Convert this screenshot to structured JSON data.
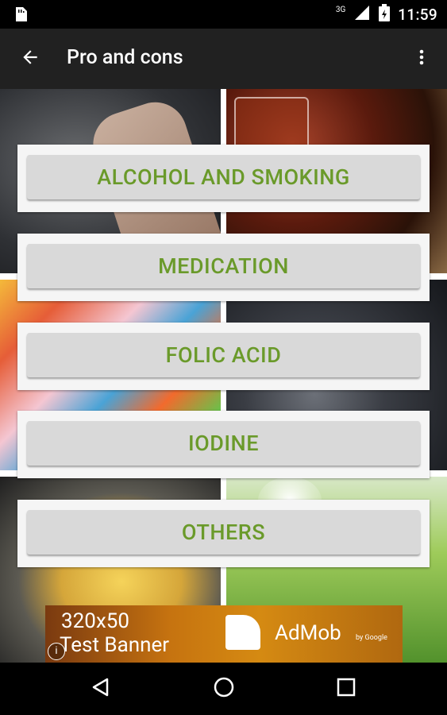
{
  "status_bar": {
    "network": "3G",
    "time": "11:59"
  },
  "app_bar": {
    "title": "Pro and cons",
    "back_icon": "arrow-back-icon",
    "overflow_icon": "more-vert-icon"
  },
  "menu": [
    {
      "label": "ALCOHOL AND SMOKING"
    },
    {
      "label": "MEDICATION"
    },
    {
      "label": "FOLIC ACID"
    },
    {
      "label": "IODINE"
    },
    {
      "label": "OTHERS"
    }
  ],
  "ad": {
    "size": "320x50",
    "text": "Test Banner",
    "brand": "AdMob",
    "by": "by Google"
  },
  "nav": {
    "back": "nav-back-icon",
    "home": "nav-home-icon",
    "recents": "nav-recents-icon"
  },
  "colors": {
    "accent_text": "#6a9a2a",
    "app_bar": "#212121",
    "card_bg": "#f5f5f5",
    "button_bg": "#d9d9d9"
  }
}
